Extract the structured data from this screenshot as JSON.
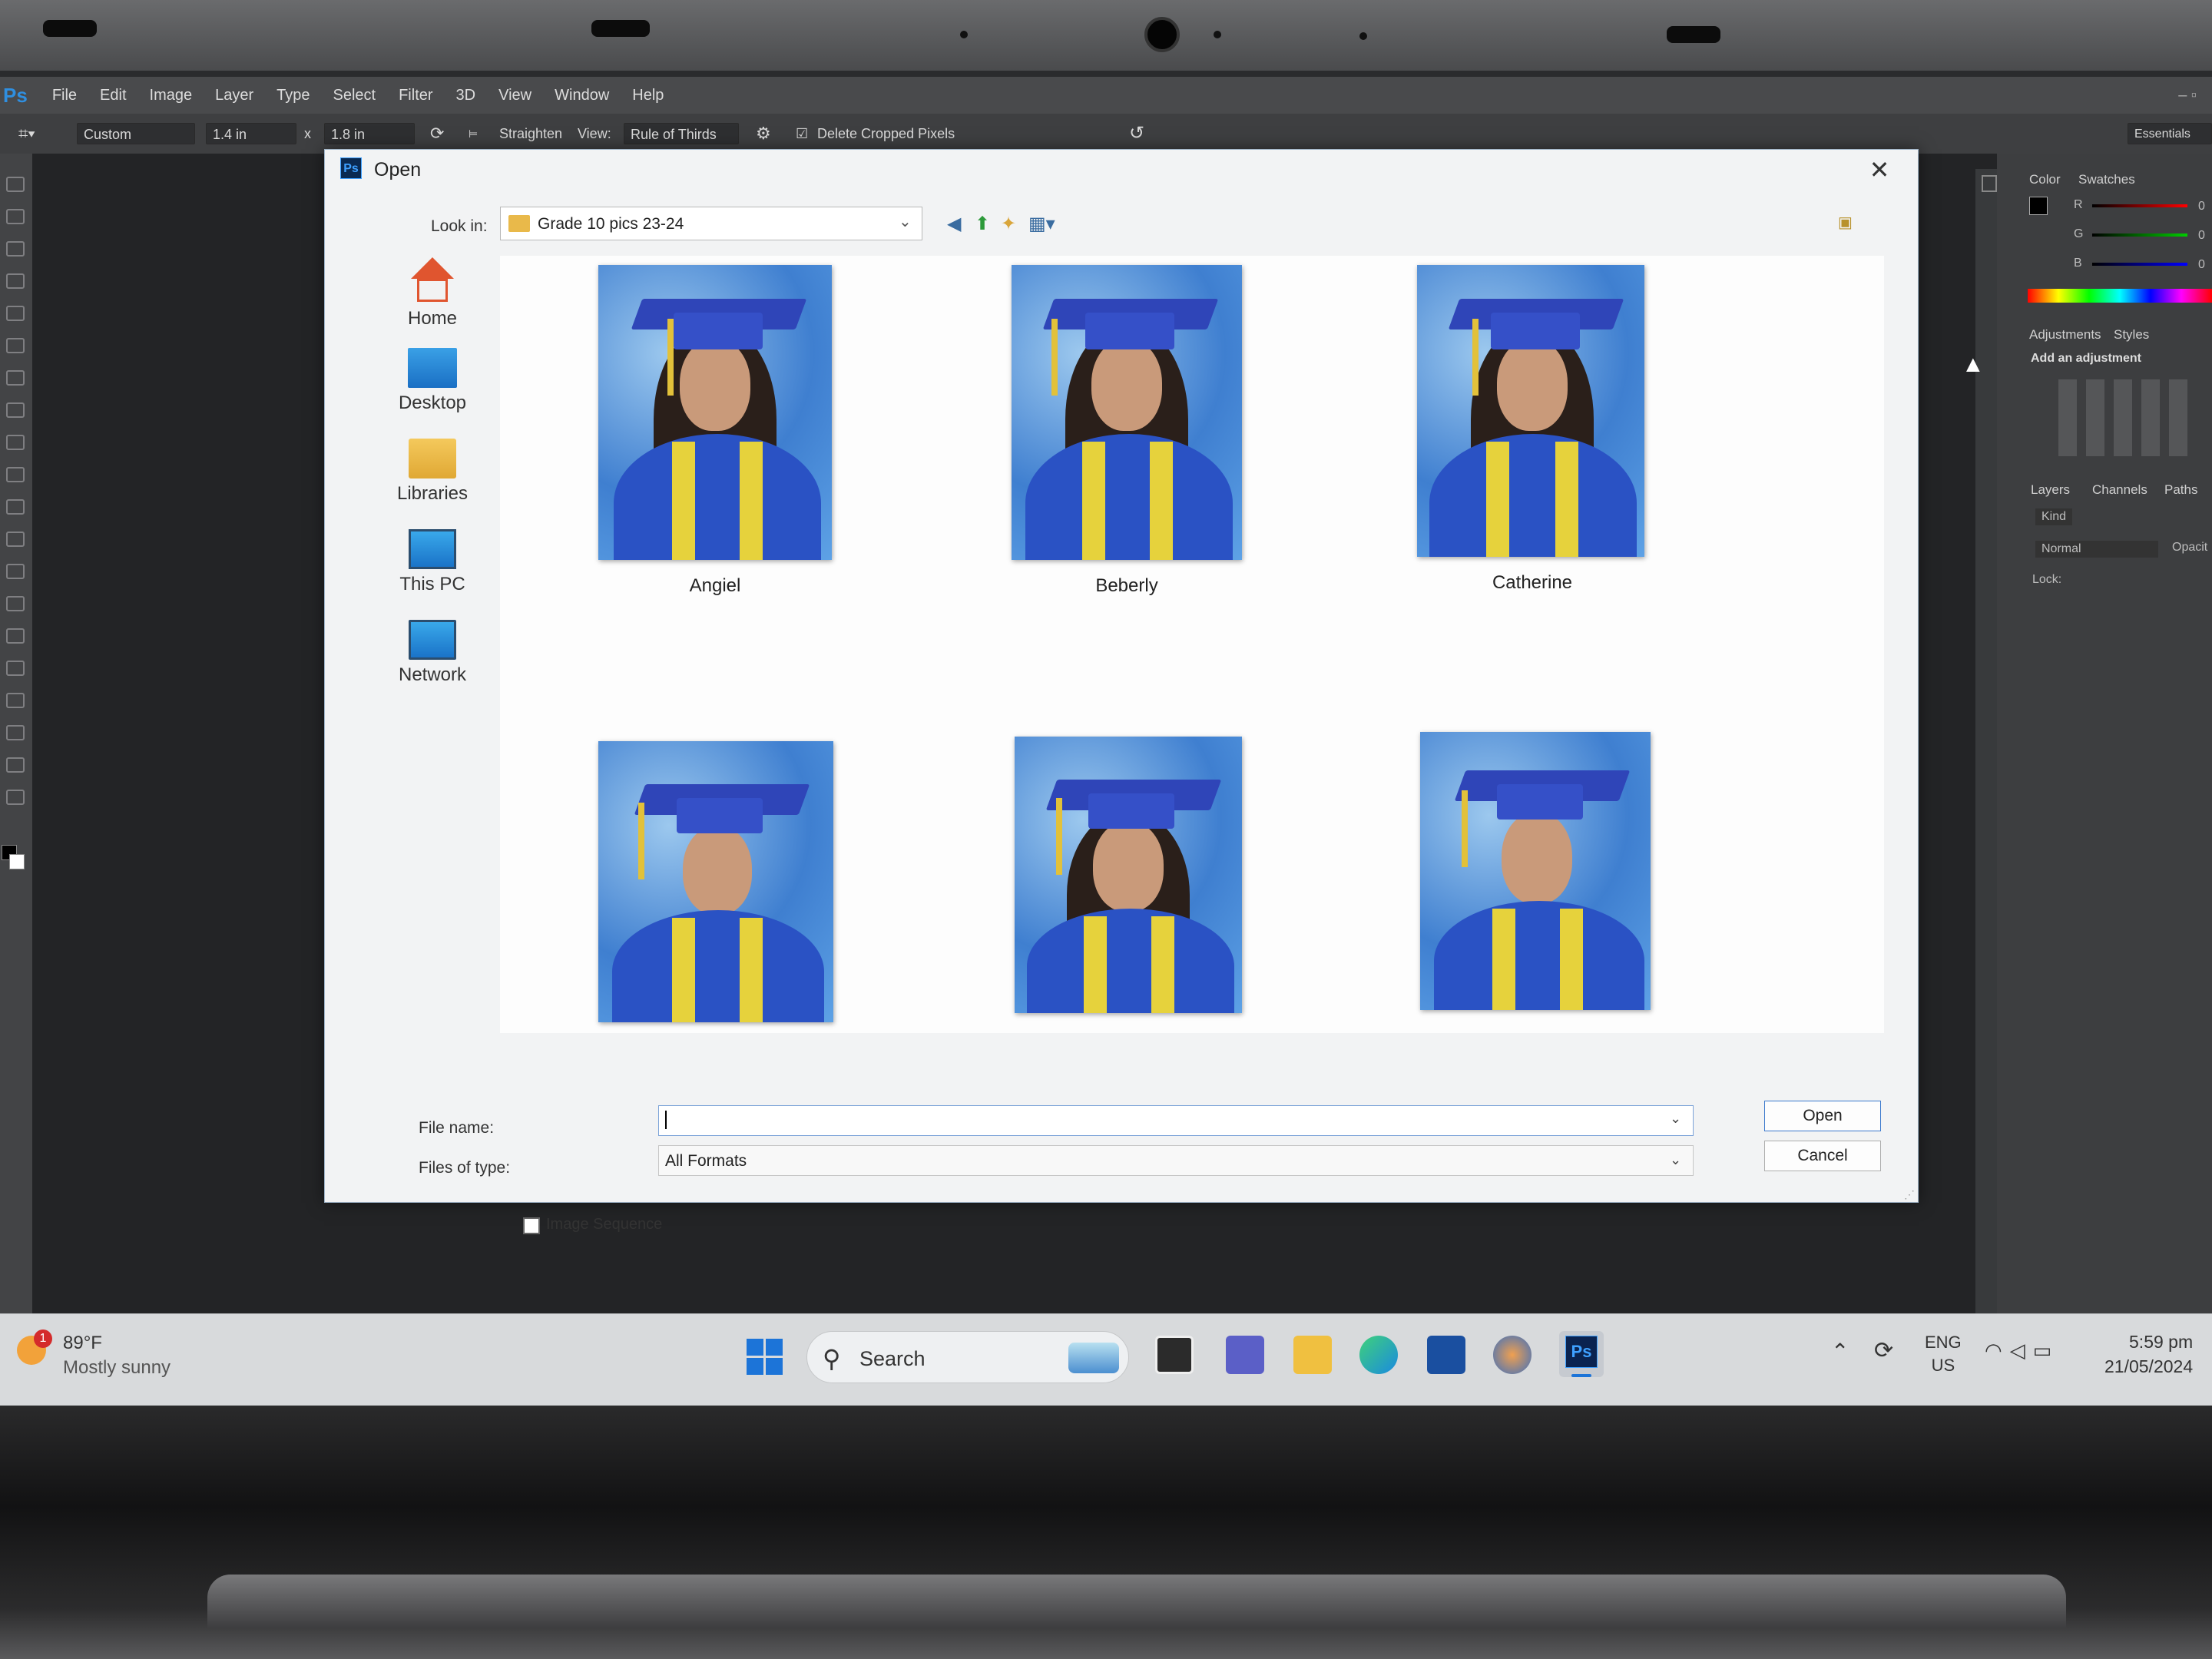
{
  "photoshop": {
    "menu": [
      "File",
      "Edit",
      "Image",
      "Layer",
      "Type",
      "Select",
      "Filter",
      "3D",
      "View",
      "Window",
      "Help"
    ],
    "options": {
      "ratio": "Custom",
      "width": "1.4 in",
      "times": "x",
      "height": "1.8 in",
      "straighten": "Straighten",
      "view_label": "View:",
      "view_value": "Rule of Thirds",
      "delete_cropped": "Delete Cropped Pixels",
      "workspace": "Essentials"
    },
    "panels": {
      "color_tab": "Color",
      "swatches_tab": "Swatches",
      "r": "R",
      "g": "G",
      "b": "B",
      "r_val": "0",
      "g_val": "0",
      "b_val": "0",
      "adjustments_tab": "Adjustments",
      "styles_tab": "Styles",
      "add_adjustment": "Add an adjustment",
      "layers_tab": "Layers",
      "channels_tab": "Channels",
      "paths_tab": "Paths",
      "kind": "Kind",
      "blend_mode": "Normal",
      "opacity": "Opacit",
      "lock": "Lock:"
    }
  },
  "dialog": {
    "title": "Open",
    "look_in_label": "Look in:",
    "look_in_value": "Grade 10 pics 23-24",
    "places": [
      {
        "label": "Home",
        "icon": "home-icon"
      },
      {
        "label": "Desktop",
        "icon": "desktop-icon"
      },
      {
        "label": "Libraries",
        "icon": "libraries-icon"
      },
      {
        "label": "This PC",
        "icon": "this-pc-icon"
      },
      {
        "label": "Network",
        "icon": "network-icon"
      }
    ],
    "files": [
      {
        "label": "Angiel"
      },
      {
        "label": "Beberly"
      },
      {
        "label": "Catherine"
      },
      {
        "label": ""
      },
      {
        "label": ""
      },
      {
        "label": ""
      }
    ],
    "file_name_label": "File name:",
    "file_name_value": "",
    "files_of_type_label": "Files of type:",
    "files_of_type_value": "All Formats",
    "open_button": "Open",
    "cancel_button": "Cancel",
    "image_sequence_label": "Image Sequence",
    "image_sequence_checked": false
  },
  "taskbar": {
    "weather_badge": "1",
    "weather_temp": "89°F",
    "weather_desc": "Mostly sunny",
    "search_label": "Search",
    "lang_line1": "ENG",
    "lang_line2": "US",
    "time": "5:59 pm",
    "date": "21/05/2024"
  },
  "colors": {
    "ps_accent": "#2f8fe0",
    "dialog_bg": "#f2f3f4",
    "open_button_border": "#3b79cd",
    "taskbar_bg": "#d8dadc"
  }
}
